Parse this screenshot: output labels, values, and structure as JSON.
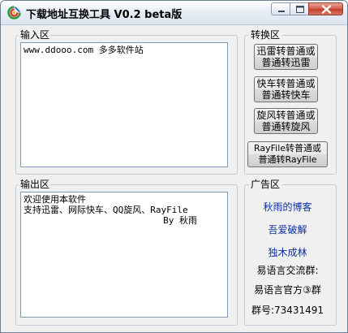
{
  "window": {
    "title": "下载地址互换工具 V0.2 beta版"
  },
  "input_section": {
    "label": "输入区",
    "value": "www.ddooo.com 多多软件站"
  },
  "output_section": {
    "label": "输出区",
    "value": "欢迎使用本软件\n支持迅雷、网际快车、QQ旋风、RayFile\n                          By 秋雨"
  },
  "convert_section": {
    "label": "转换区",
    "buttons": [
      {
        "line1": "迅雷转普通或",
        "line2": "普通转迅雷"
      },
      {
        "line1": "快车转普通或",
        "line2": "普通转快车"
      },
      {
        "line1": "旋风转普通或",
        "line2": "普通转旋风"
      },
      {
        "line1": "RayFile转普通或",
        "line2": "普通转RayFile"
      }
    ]
  },
  "ad_section": {
    "label": "广告区",
    "links": [
      "秋雨的博客",
      "吾爱破解",
      "独木成林"
    ],
    "texts": [
      "易语言交流群:",
      "易语言官方③群",
      "群号:73431491"
    ]
  },
  "colors": {
    "link": "#0b2ea5",
    "close_button": "#c2402a"
  }
}
